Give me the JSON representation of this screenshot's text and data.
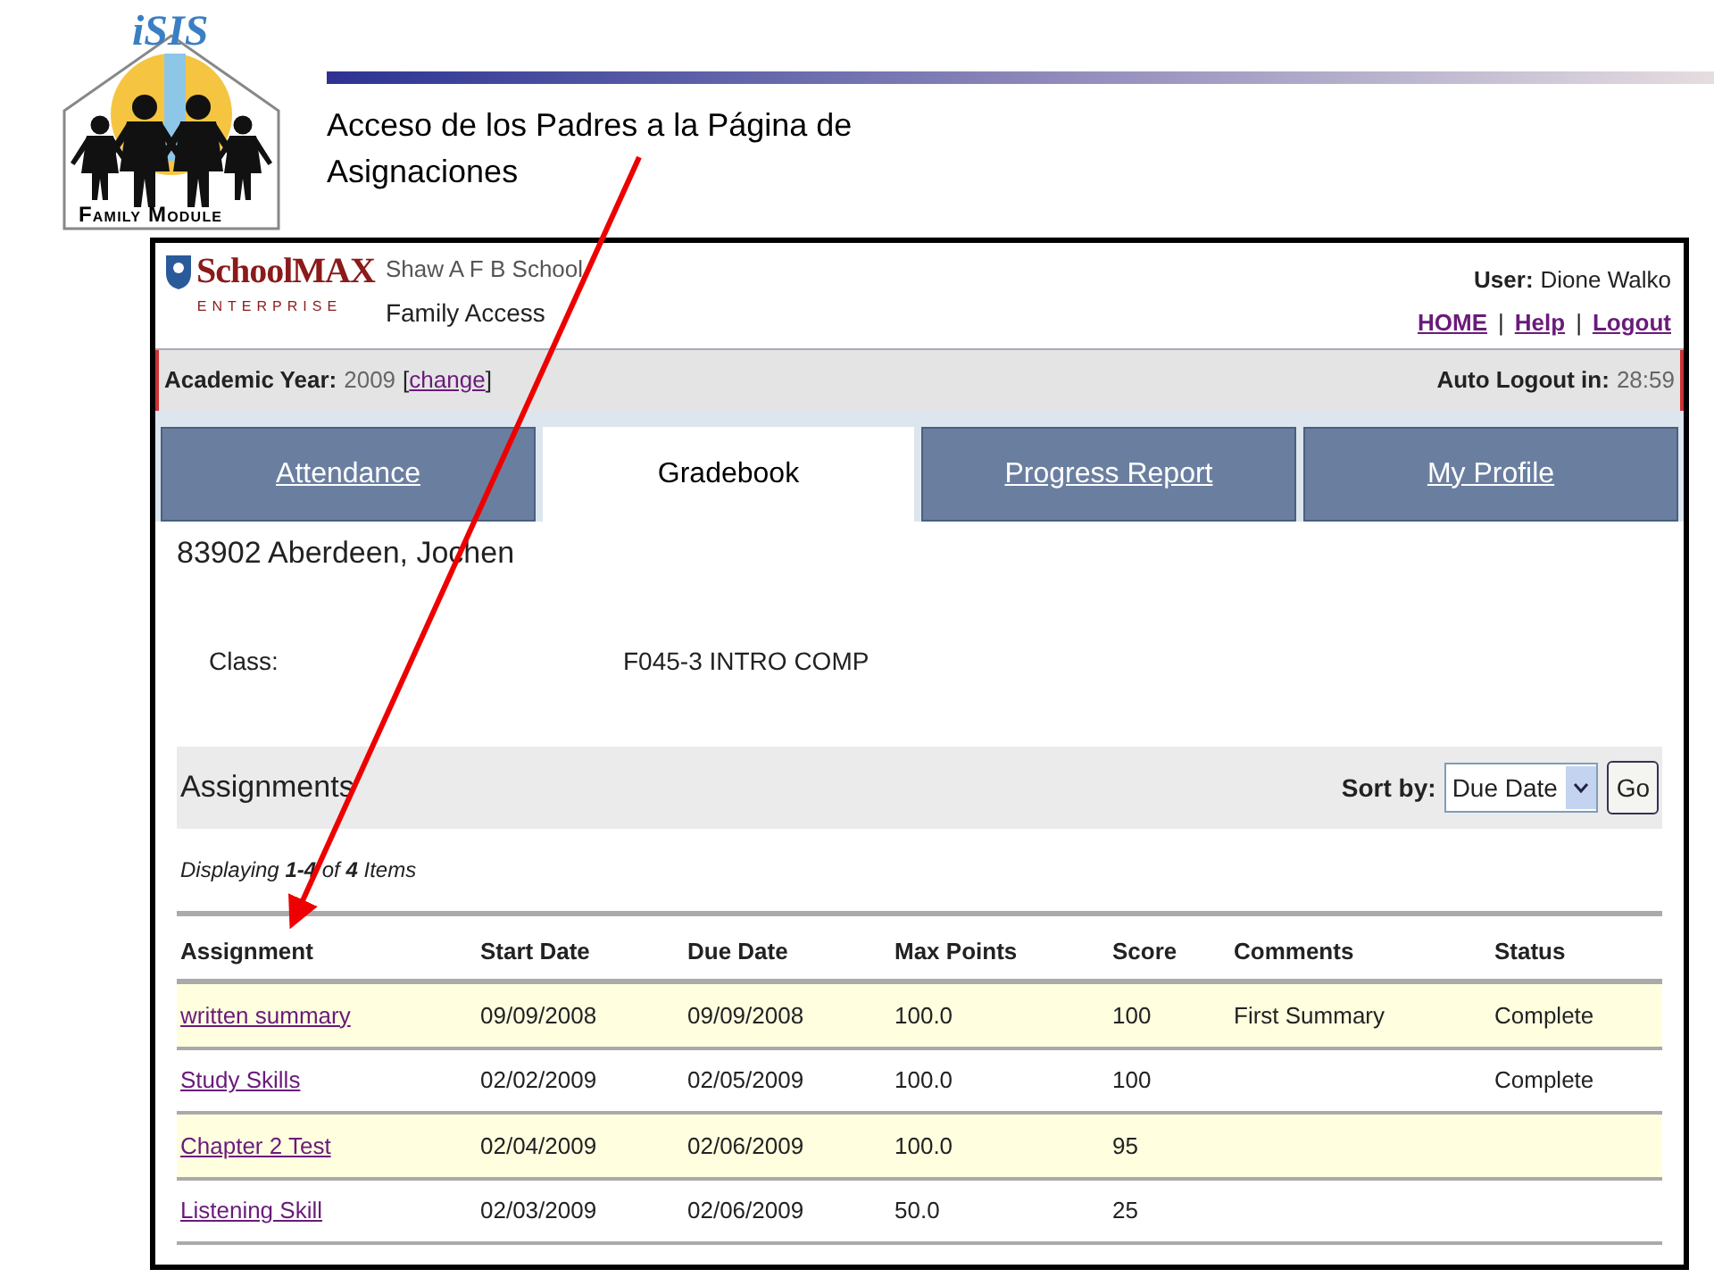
{
  "slide": {
    "logo": {
      "mark": "iSIS",
      "caption": "Family Module"
    },
    "title": "Acceso de los Padres a la Página de Asignaciones"
  },
  "app": {
    "brand": {
      "name": "SchoolMAX",
      "sub": "ENTERPRISE"
    },
    "school": "Shaw A F B School",
    "portal": "Family Access",
    "user": {
      "label": "User:",
      "name": "Dione Walko"
    },
    "links": [
      "HOME",
      "Help",
      "Logout"
    ],
    "separator": "|",
    "academic_year": {
      "label": "Academic Year:",
      "value": "2009",
      "open": "[",
      "link": "change",
      "close": "]"
    },
    "auto_logout": {
      "label": "Auto Logout in:",
      "value": "28:59"
    },
    "tabs": [
      {
        "label": "Attendance",
        "selected": false
      },
      {
        "label": "Gradebook",
        "selected": true
      },
      {
        "label": "Progress Report",
        "selected": false
      },
      {
        "label": "My Profile",
        "selected": false
      }
    ],
    "student": "83902 Aberdeen, Jochen",
    "class": {
      "label": "Class:",
      "value": "F045-3 INTRO COMP"
    },
    "assignments": {
      "title": "Assignments",
      "sort_label": "Sort by:",
      "sort_value": "Due Date",
      "go": "Go",
      "displaying": "Displaying **1-4** of **4** Items",
      "columns": [
        "Assignment",
        "Start Date",
        "Due Date",
        "Max Points",
        "Score",
        "Comments",
        "Status"
      ],
      "rows": [
        {
          "assignment": "written summary",
          "start_date": "09/09/2008",
          "due_date": "09/09/2008",
          "max_points": "100.0",
          "score": "100",
          "comments": "First Summary",
          "status": "Complete"
        },
        {
          "assignment": "Study Skills",
          "start_date": "02/02/2009",
          "due_date": "02/05/2009",
          "max_points": "100.0",
          "score": "100",
          "status": "Complete"
        },
        {
          "assignment": "Chapter 2 Test",
          "start_date": "02/04/2009",
          "due_date": "02/06/2009",
          "max_points": "100.0",
          "score": "95"
        },
        {
          "assignment": "Listening Skill",
          "start_date": "02/03/2009",
          "due_date": "02/06/2009",
          "max_points": "50.0",
          "score": "25"
        }
      ]
    }
  }
}
